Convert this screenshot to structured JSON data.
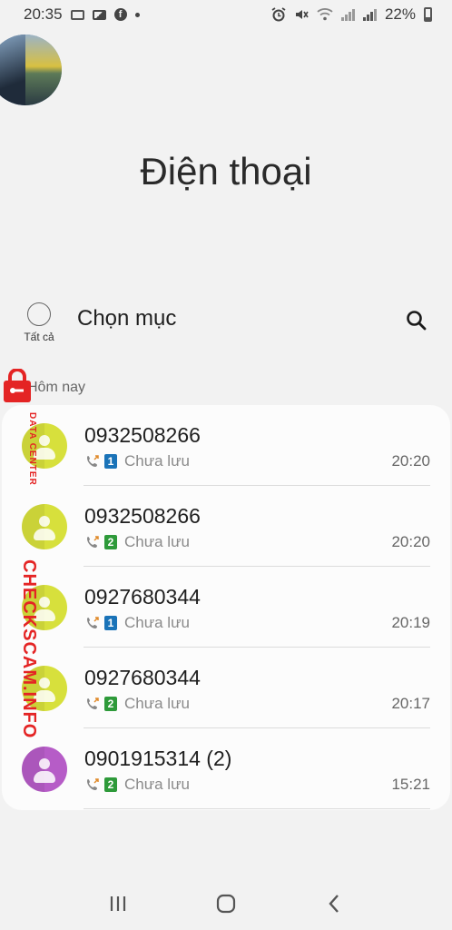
{
  "status_bar": {
    "time": "20:35",
    "left_icons": [
      "screen-icon",
      "gallery-icon",
      "facebook-icon",
      "dot-icon"
    ],
    "right_icons": [
      "alarm-icon",
      "mute-icon",
      "wifi-icon",
      "signal-icon",
      "signal-icon",
      "battery-icon"
    ],
    "battery": "22%"
  },
  "header": {
    "title": "Điện thoại"
  },
  "toolbar": {
    "select_all_label": "Tất cả",
    "choose_title": "Chọn mục",
    "search_icon": "search-icon"
  },
  "section": {
    "label": "Hôm nay"
  },
  "calls": [
    {
      "number": "0932508266",
      "sim": "1",
      "sim_color": "#1a73b8",
      "status": "Chưa lưu",
      "time": "20:20",
      "avatar_color": "#d7e03c"
    },
    {
      "number": "0932508266",
      "sim": "2",
      "sim_color": "#2e9a3a",
      "status": "Chưa lưu",
      "time": "20:20",
      "avatar_color": "#d7e03c"
    },
    {
      "number": "0927680344",
      "sim": "1",
      "sim_color": "#1a73b8",
      "status": "Chưa lưu",
      "time": "20:19",
      "avatar_color": "#d7e03c"
    },
    {
      "number": "0927680344",
      "sim": "2",
      "sim_color": "#2e9a3a",
      "status": "Chưa lưu",
      "time": "20:17",
      "avatar_color": "#d7e03c"
    },
    {
      "number": "0901915314 (2)",
      "sim": "2",
      "sim_color": "#2e9a3a",
      "status": "Chưa lưu",
      "time": "15:21",
      "avatar_color": "#b65cc7"
    }
  ],
  "watermark": {
    "brand": "CHECKSCAM.INFO",
    "sub": "DATA CENTER",
    "color": "#e42424"
  },
  "nav_bar": {
    "icons": [
      "recent-apps-icon",
      "home-icon",
      "back-icon"
    ]
  }
}
